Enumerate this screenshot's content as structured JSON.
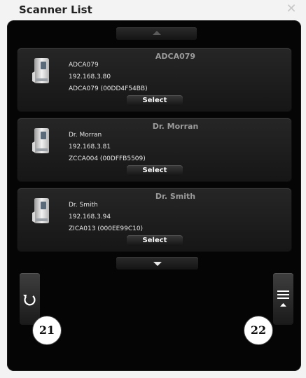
{
  "window": {
    "title": "Scanner List",
    "close_glyph": "✕"
  },
  "scanners": [
    {
      "header": "ADCA079",
      "name": "ADCA079",
      "ip": "192.168.3.80",
      "device": "ADCA079 (00DD4F54BB)",
      "select_label": "Select"
    },
    {
      "header": "Dr. Morran",
      "name": "Dr. Morran",
      "ip": "192.168.3.81",
      "device": "ZCCA004 (00DFFB5509)",
      "select_label": "Select"
    },
    {
      "header": "Dr. Smith",
      "name": "Dr. Smith",
      "ip": "192.168.3.94",
      "device": "ZICA013 (000EE99C10)",
      "select_label": "Select"
    }
  ],
  "icons": {
    "scroll_up": "triangle-up-icon",
    "scroll_down": "triangle-down-icon",
    "refresh": "refresh-icon",
    "menu": "menu-icon",
    "scanner": "scanner-device-icon"
  },
  "callouts": {
    "left": "21",
    "right": "22"
  },
  "colors": {
    "panel_bg": "#050505",
    "card_bg": "#1f1f1f",
    "card_title": "#9a9a9a",
    "text": "#e6e6e6"
  }
}
